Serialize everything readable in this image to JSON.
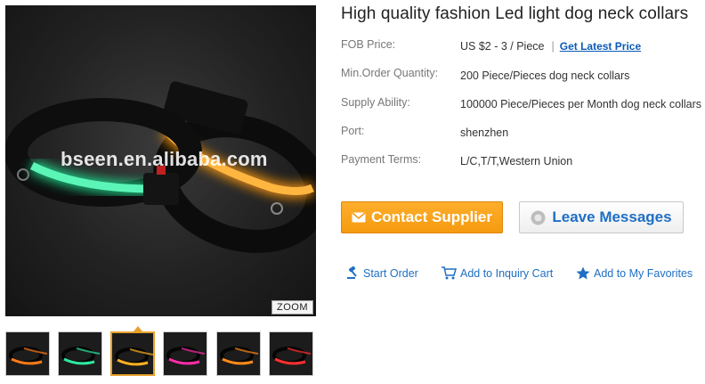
{
  "product": {
    "title": "High quality fashion Led light dog neck collars",
    "watermark": "bseen.en.alibaba.com",
    "zoom_label": "ZOOM"
  },
  "details": [
    {
      "label": "FOB Price:",
      "value": "US $2 - 3 / Piece",
      "link": "Get Latest Price"
    },
    {
      "label": "Min.Order Quantity:",
      "value": "200 Piece/Pieces dog neck collars"
    },
    {
      "label": "Supply Ability:",
      "value": "100000 Piece/Pieces per Month dog neck collars"
    },
    {
      "label": "Port:",
      "value": "shenzhen"
    },
    {
      "label": "Payment Terms:",
      "value": "L/C,T/T,Western Union"
    }
  ],
  "buttons": {
    "contact": "Contact Supplier",
    "leave": "Leave Messages"
  },
  "actions": {
    "start_order": "Start Order",
    "inquiry_cart": "Add to Inquiry Cart",
    "favorites": "Add to My Favorites"
  },
  "thumbnails": [
    {
      "glow": "#ff7a1a",
      "selected": false
    },
    {
      "glow": "#2ee8a0",
      "selected": false
    },
    {
      "glow": "#ffb020",
      "selected": true
    },
    {
      "glow": "#ff2ea8",
      "selected": false
    },
    {
      "glow": "#ff8a1a",
      "selected": false
    },
    {
      "glow": "#ff3030",
      "selected": false
    }
  ],
  "colors": {
    "accent_orange": "#f59a0f",
    "link_blue": "#1f6fc4",
    "collar_green": "#2ee8a0",
    "collar_orange": "#ffa51e"
  }
}
